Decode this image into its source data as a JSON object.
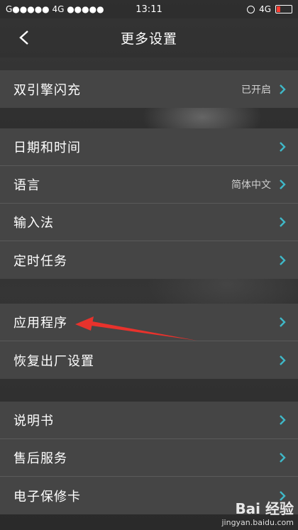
{
  "status_bar": {
    "carrier": "G●●●●● 4G ●●●●●",
    "time": "13:11",
    "network": "4G"
  },
  "header": {
    "title": "更多设置"
  },
  "groups": [
    {
      "items": [
        {
          "label": "双引擎闪充",
          "value": "已开启"
        }
      ]
    },
    {
      "items": [
        {
          "label": "日期和时间",
          "value": ""
        },
        {
          "label": "语言",
          "value": "简体中文"
        },
        {
          "label": "输入法",
          "value": ""
        },
        {
          "label": "定时任务",
          "value": ""
        }
      ]
    },
    {
      "items": [
        {
          "label": "应用程序",
          "value": ""
        },
        {
          "label": "恢复出厂设置",
          "value": ""
        }
      ]
    },
    {
      "items": [
        {
          "label": "说明书",
          "value": ""
        },
        {
          "label": "售后服务",
          "value": ""
        },
        {
          "label": "电子保修卡",
          "value": ""
        }
      ]
    }
  ],
  "watermark": {
    "brand": "Bai 经验",
    "url": "jingyan.baidu.com"
  },
  "colors": {
    "chevron": "#3fb8c8",
    "annotation_arrow": "#e8322c"
  }
}
